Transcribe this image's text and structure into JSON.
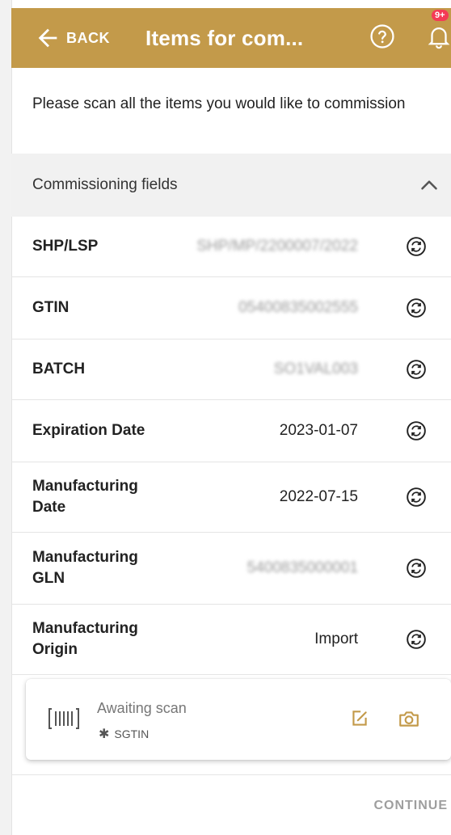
{
  "header": {
    "back_label": "BACK",
    "title": "Items for com...",
    "notification_badge": "9+",
    "accent_color": "#c39a4a"
  },
  "instruction": "Please scan all the items you would like to commission",
  "section": {
    "title": "Commissioning fields"
  },
  "fields": [
    {
      "label": "SHP/LSP",
      "value": "SHP/MP/2200007/2022",
      "blurred": true
    },
    {
      "label": "GTIN",
      "value": "05400835002555",
      "blurred": true
    },
    {
      "label": "BATCH",
      "value": "SO1VAL003",
      "blurred": true
    },
    {
      "label": "Expiration Date",
      "value": "2023-01-07",
      "blurred": false
    },
    {
      "label": "Manufacturing Date",
      "value": "2022-07-15",
      "blurred": false
    },
    {
      "label": "Manufacturing GLN",
      "value": "5400835000001",
      "blurred": true
    },
    {
      "label": "Manufacturing Origin",
      "value": "Import",
      "blurred": false
    }
  ],
  "scan": {
    "status": "Awaiting scan",
    "type_marker": "✱",
    "type": "SGTIN"
  },
  "footer": {
    "continue_label": "CONTINUE"
  }
}
